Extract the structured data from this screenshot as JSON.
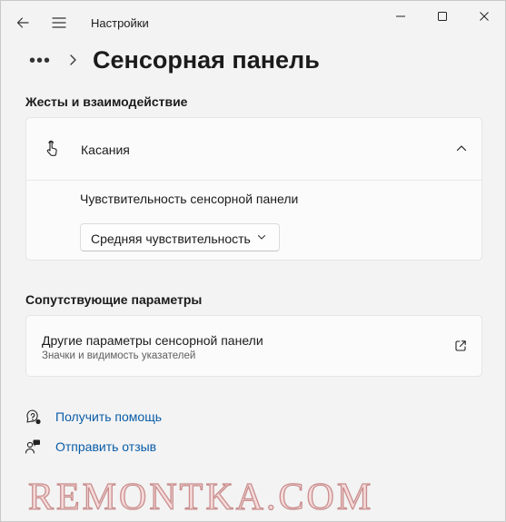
{
  "titlebar": {
    "app_title": "Настройки",
    "icons": [
      "back-arrow-icon",
      "hamburger-menu-icon",
      "minimize-icon",
      "maximize-icon",
      "close-icon"
    ]
  },
  "header": {
    "more": "•••",
    "page_title": "Сенсорная панель"
  },
  "gestures_section": {
    "title": "Жесты и взаимодействие",
    "taps": {
      "label": "Касания",
      "icon": "touch-hand-icon",
      "expanded": true,
      "sensitivity_label": "Чувствительность сенсорной панели",
      "sensitivity_value": "Средняя чувствительность"
    }
  },
  "related_section": {
    "title": "Сопутствующие параметры",
    "item": {
      "title": "Другие параметры сенсорной панели",
      "subtitle": "Значки и видимость указателей",
      "icon": "external-link-icon"
    }
  },
  "links": {
    "help": "Получить помощь",
    "feedback": "Отправить отзыв"
  },
  "watermark": "REMONTKA.COM",
  "colors": {
    "window_bg": "#f3f3f3",
    "card_bg": "#fbfbfb",
    "link": "#0a5ca8"
  }
}
